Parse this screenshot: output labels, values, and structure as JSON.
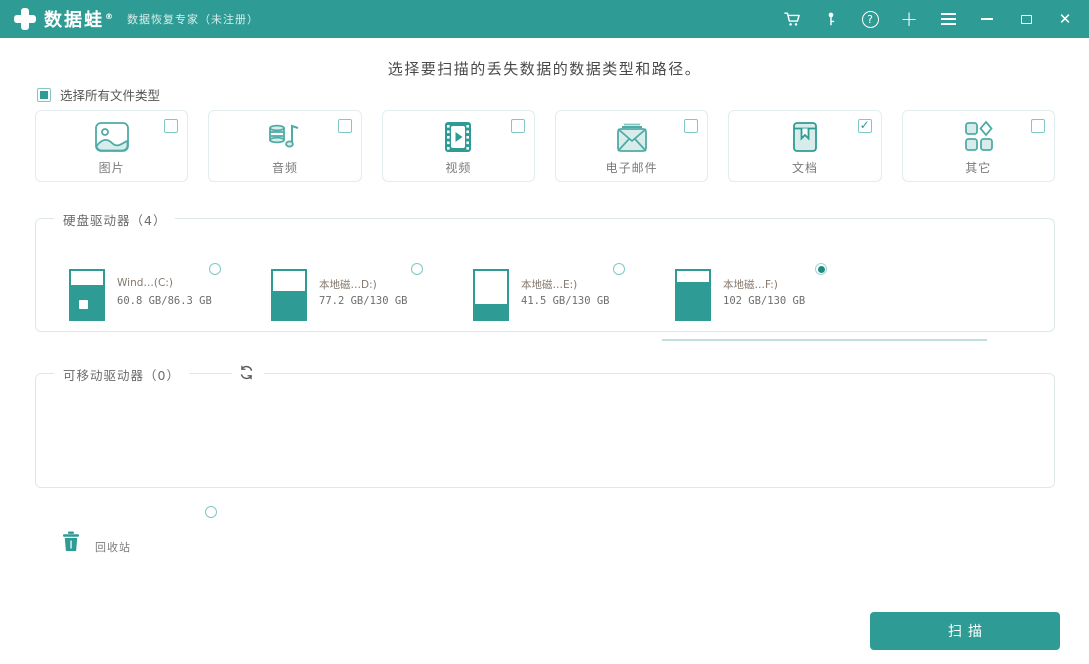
{
  "header": {
    "brand": "数据蛙",
    "brand_mark": "®",
    "subtitle": "数据恢复专家（未注册）"
  },
  "main": {
    "title": "选择要扫描的丢失数据的数据类型和路径。",
    "select_all": {
      "label": "选择所有文件类型",
      "indeterminate": true
    },
    "file_types": [
      {
        "label": "图片",
        "icon": "image-icon",
        "checked": false
      },
      {
        "label": "音频",
        "icon": "audio-icon",
        "checked": false
      },
      {
        "label": "视频",
        "icon": "video-icon",
        "checked": false
      },
      {
        "label": "电子邮件",
        "icon": "email-icon",
        "checked": false
      },
      {
        "label": "文档",
        "icon": "document-icon",
        "checked": true
      },
      {
        "label": "其它",
        "icon": "other-icon",
        "checked": false
      }
    ],
    "hard_drives": {
      "legend": "硬盘驱动器（4）",
      "drives": [
        {
          "name": "Wind…(C:)",
          "capacity": "60.8 GB/86.3 GB",
          "fill_percent": 70,
          "selected": false,
          "windows_logo": true
        },
        {
          "name": "本地磁…D:)",
          "capacity": "77.2 GB/130 GB",
          "fill_percent": 59,
          "selected": false,
          "windows_logo": false
        },
        {
          "name": "本地磁…E:)",
          "capacity": "41.5 GB/130 GB",
          "fill_percent": 32,
          "selected": false,
          "windows_logo": false
        },
        {
          "name": "本地磁…F:)",
          "capacity": "102 GB/130 GB",
          "fill_percent": 78,
          "selected": true,
          "windows_logo": false
        }
      ]
    },
    "removable_drives": {
      "legend": "可移动驱动器（0）",
      "count": 0
    },
    "recycle_bin": {
      "label": "回收站",
      "selected": false
    },
    "scan_label": "扫描"
  },
  "colors": {
    "accent": "#2e9c95",
    "accent_light": "#7fc8c3",
    "icon_fill": "#d8edeb",
    "icon_stroke": "#4faba5"
  }
}
